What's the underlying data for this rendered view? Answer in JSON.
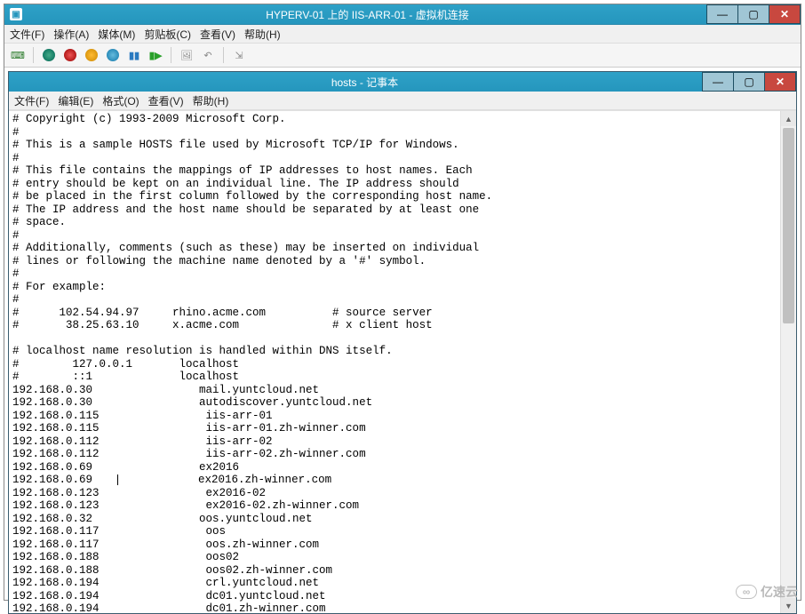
{
  "hyperv": {
    "title": "HYPERV-01 上的 IIS-ARR-01 - 虚拟机连接",
    "menu": [
      "文件(F)",
      "操作(A)",
      "媒体(M)",
      "剪贴板(C)",
      "查看(V)",
      "帮助(H)"
    ]
  },
  "notepad": {
    "title": "hosts - 记事本",
    "menu": [
      "文件(F)",
      "编辑(E)",
      "格式(O)",
      "查看(V)",
      "帮助(H)"
    ],
    "caret_line": 29,
    "content_lines": [
      "# Copyright (c) 1993-2009 Microsoft Corp.",
      "#",
      "# This is a sample HOSTS file used by Microsoft TCP/IP for Windows.",
      "#",
      "# This file contains the mappings of IP addresses to host names. Each",
      "# entry should be kept on an individual line. The IP address should",
      "# be placed in the first column followed by the corresponding host name.",
      "# The IP address and the host name should be separated by at least one",
      "# space.",
      "#",
      "# Additionally, comments (such as these) may be inserted on individual",
      "# lines or following the machine name denoted by a '#' symbol.",
      "#",
      "# For example:",
      "#",
      "#      102.54.94.97     rhino.acme.com          # source server",
      "#       38.25.63.10     x.acme.com              # x client host",
      "",
      "# localhost name resolution is handled within DNS itself.",
      "#\t127.0.0.1       localhost",
      "#\t::1             localhost",
      "192.168.0.30\t\tmail.yuntcloud.net",
      "192.168.0.30\t\tautodiscover.yuntcloud.net",
      "192.168.0.115\t\tiis-arr-01",
      "192.168.0.115\t\tiis-arr-01.zh-winner.com",
      "192.168.0.112\t\tiis-arr-02",
      "192.168.0.112\t\tiis-arr-02.zh-winner.com",
      "192.168.0.69\t\tex2016",
      "192.168.0.69\t\tex2016.zh-winner.com",
      "192.168.0.123\t\tex2016-02",
      "192.168.0.123\t\tex2016-02.zh-winner.com",
      "192.168.0.32\t\toos.yuntcloud.net",
      "192.168.0.117\t\toos",
      "192.168.0.117\t\toos.zh-winner.com",
      "192.168.0.188\t\toos02",
      "192.168.0.188\t\toos02.zh-winner.com",
      "192.168.0.194\t\tcrl.yuntcloud.net",
      "192.168.0.194\t\tdc01.yuntcloud.net",
      "192.168.0.194\t\tdc01.zh-winner.com"
    ]
  },
  "watermark": "亿速云"
}
